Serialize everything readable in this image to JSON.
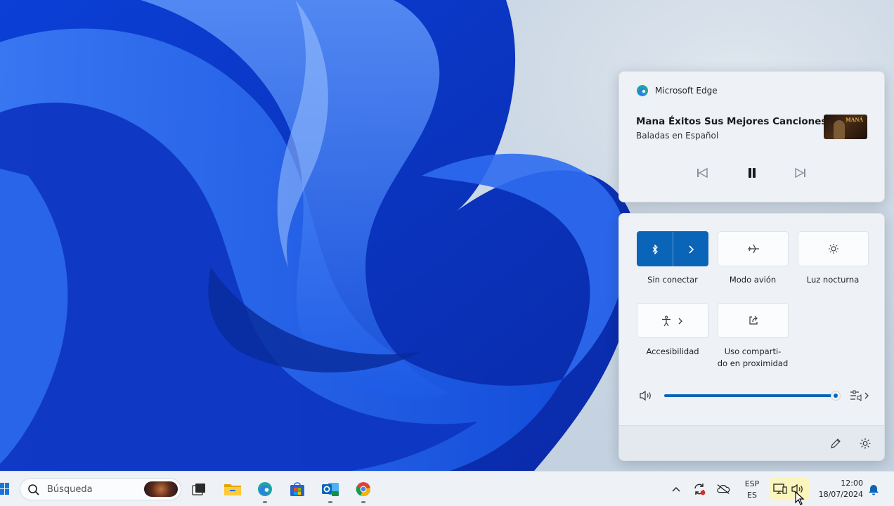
{
  "media": {
    "app_name": "Microsoft Edge",
    "title": "Mana Éxitos Sus Mejores Canciones...",
    "subtitle": "Baladas en Español",
    "album_text": "MANÁ"
  },
  "quick_settings": {
    "tiles": [
      {
        "label": "Sin conectar",
        "icon": "bluetooth-icon",
        "active": true
      },
      {
        "label": "Modo avión",
        "icon": "airplane-icon",
        "active": false
      },
      {
        "label": "Luz nocturna",
        "icon": "night-light-icon",
        "active": false
      },
      {
        "label": "Accesibilidad",
        "icon": "accessibility-icon",
        "active": false
      },
      {
        "label_line1": "Uso comparti-",
        "label_line2": "do en proximidad",
        "icon": "nearby-share-icon",
        "active": false
      }
    ],
    "volume_level_percent": 100
  },
  "taskbar": {
    "search_placeholder": "Búsqueda",
    "language_line1": "ESP",
    "language_line2": "ES",
    "time": "12:00",
    "date": "18/07/2024"
  },
  "colors": {
    "accent": "#0a64b8",
    "panel_bg": "#eef2f7",
    "taskbar_bg": "#eef1f5"
  }
}
